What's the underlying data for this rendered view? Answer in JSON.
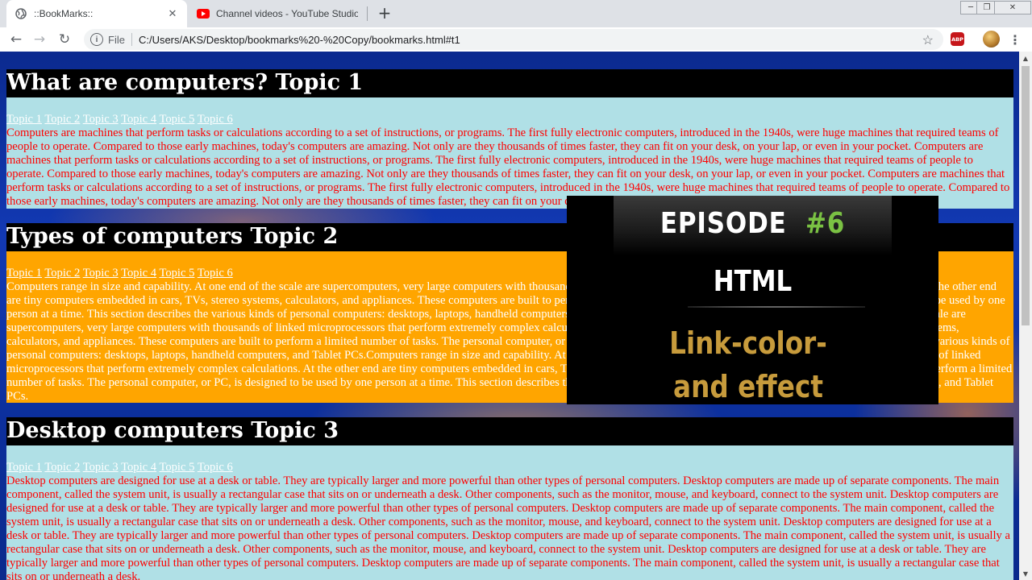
{
  "browser": {
    "tabs": [
      {
        "title": "::BookMarks::",
        "active": true,
        "favicon": "globe-icon"
      },
      {
        "title": "Channel videos - YouTube Studio",
        "active": false,
        "favicon": "youtube-icon"
      }
    ],
    "tab_close_glyph": "✕",
    "new_tab_glyph": "+",
    "window_controls": {
      "minimize": "─",
      "restore": "❐",
      "close": "✕"
    },
    "nav": {
      "back": "←",
      "forward": "→",
      "reload": "↻"
    },
    "address": {
      "scheme": "File",
      "url": "C:/Users/AKS/Desktop/bookmarks%20-%20Copy/bookmarks.html#t1",
      "info_glyph": "i",
      "star_glyph": "☆"
    },
    "extension_label": "ABP",
    "menu_glyph": "⋮"
  },
  "page": {
    "links": [
      "Topic 1",
      "Topic 2",
      "Topic 3",
      "Topic 4",
      "Topic 5",
      "Topic 6"
    ],
    "sections": [
      {
        "heading": "What are computers? Topic 1",
        "text": "Computers are machines that perform tasks or calculations according to a set of instructions, or programs. The first fully electronic computers, introduced in the 1940s, were huge machines that required teams of people to operate. Compared to those early machines, today's computers are amazing. Not only are they thousands of times faster, they can fit on your desk, on your lap, or even in your pocket. Computers are machines that perform tasks or calculations according to a set of instructions, or programs. The first fully electronic computers, introduced in the 1940s, were huge machines that required teams of people to operate. Compared to those early machines, today's computers are amazing. Not only are they thousands of times faster, they can fit on your desk, on your lap, or even in your pocket. Computers are machines that perform tasks or calculations according to a set of instructions, or programs. The first fully electronic computers, introduced in the 1940s, were huge machines that required teams of people to operate. Compared to those early machines, today's computers are amazing. Not only are they thousands of times faster, they can fit on your desk, on your lap, or even in your pocket."
      },
      {
        "heading": "Types of computers Topic 2",
        "text": "Computers range in size and capability. At one end of the scale are supercomputers, very large computers with thousands of linked microprocessors that perform extremely complex calculations. At the other end are tiny computers embedded in cars, TVs, stereo systems, calculators, and appliances. These computers are built to perform a limited number of tasks. The personal computer, or PC, is designed to be used by one person at a time. This section describes the various kinds of personal computers: desktops, laptops, handheld computers, and Tablet PCs. Computers range in size and capability. At one end of the scale are supercomputers, very large computers with thousands of linked microprocessors that perform extremely complex calculations. At the other end are tiny computers embedded in cars, TVs, stereo systems, calculators, and appliances. These computers are built to perform a limited number of tasks. The personal computer, or PC, is designed to be used by one person at a time. This section describes the various kinds of personal computers: desktops, laptops, handheld computers, and Tablet PCs.Computers range in size and capability. At one end of the scale are supercomputers, very large computers with thousands of linked microprocessors that perform extremely complex calculations. At the other end are tiny computers embedded in cars, TVs, stereo systems, calculators, and appliances. These computers are built to perform a limited number of tasks. The personal computer, or PC, is designed to be used by one person at a time. This section describes the various kinds of personal computers: desktops, laptops, handheld computers, and Tablet PCs."
      },
      {
        "heading": "Desktop computers Topic 3",
        "text": "Desktop computers are designed for use at a desk or table. They are typically larger and more powerful than other types of personal computers. Desktop computers are made up of separate components. The main component, called the system unit, is usually a rectangular case that sits on or underneath a desk. Other components, such as the monitor, mouse, and keyboard, connect to the system unit. Desktop computers are designed for use at a desk or table. They are typically larger and more powerful than other types of personal computers. Desktop computers are made up of separate components. The main component, called the system unit, is usually a rectangular case that sits on or underneath a desk. Other components, such as the monitor, mouse, and keyboard, connect to the system unit. Desktop computers are designed for use at a desk or table. They are typically larger and more powerful than other types of personal computers. Desktop computers are made up of separate components. The main component, called the system unit, is usually a rectangular case that sits on or underneath a desk. Other components, such as the monitor, mouse, and keyboard, connect to the system unit. Desktop computers are designed for use at a desk or table. They are typically larger and more powerful than other types of personal computers. Desktop computers are made up of separate components. The main component, called the system unit, is usually a rectangular case that sits on or underneath a desk."
      }
    ]
  },
  "overlay": {
    "episode_label": "EPISODE",
    "episode_number": "#6",
    "subject": "HTML",
    "topic_line1": "Link-color-",
    "topic_line2": "and effect"
  },
  "colors": {
    "heading_bg": "#000000",
    "section_light_bg": "#b0e0e6",
    "section_orange_bg": "#ffa500",
    "text_red": "#ff0000",
    "episode_green": "#7ac143",
    "topic_gold": "#c79b3c"
  },
  "scrollbar": {
    "up_glyph": "▲",
    "down_glyph": "▼"
  }
}
